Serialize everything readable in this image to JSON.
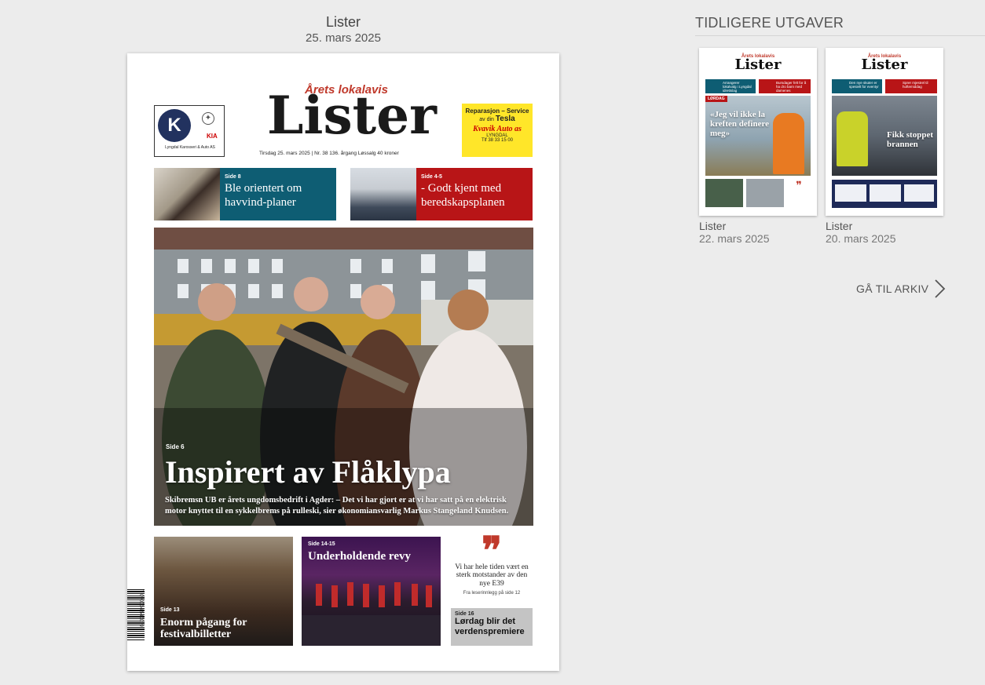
{
  "current": {
    "title": "Lister",
    "date": "25. mars 2025",
    "front": {
      "tagline": "Årets lokalavis",
      "masthead": "Lister",
      "dateline": "Tirsdag 25. mars 2025  |  Nr. 38        136. årgang   Løssalg 40 kroner",
      "left_ad": {
        "logo": "K",
        "mark": "✦",
        "brand": "KIA",
        "text": "Lyngdal Karosseri & Auto AS"
      },
      "right_ad": {
        "line1": "Reparasjon – Service",
        "line2": "av din",
        "brand": "Tesla",
        "company": "Kvavik Auto as",
        "place": "LYNGDAL",
        "phone": "Tlf 38 33 15 00"
      },
      "teasers": [
        {
          "side": "Side 8",
          "headline": "Ble orientert om havvind-planer",
          "color": "#0e5d73"
        },
        {
          "side": "Side 4-5",
          "headline": "- Godt kjent med beredskapsplanen",
          "color": "#b81517"
        }
      ],
      "hero": {
        "side": "Side 6",
        "headline": "Inspirert av Flåklypa",
        "subtext": "Skibremsn UB er årets ungdomsbedrift i Agder: – Det vi har gjort er at vi har satt på en elektrisk motor knyttet til en sykkelbrems på rulleski, sier økonomiansvarlig Markus Stangeland Knudsen."
      },
      "bottom": [
        {
          "side": "Side 13",
          "headline": "Enorm pågang for festivalbilletter"
        },
        {
          "side": "Side 14-15",
          "headline": "Underholdende revy"
        }
      ],
      "quote": {
        "mark": "❞",
        "text": "Vi har hele tiden vært en sterk motstander av den nye E39",
        "source": "Fra leserinnlegg på side 12"
      },
      "grey_box": {
        "side": "Side 16",
        "headline": "Lørdag blir det verdenspremiere"
      },
      "barcode_number": "7 090034 540019"
    }
  },
  "sidebar": {
    "heading": "TIDLIGERE UTGAVER",
    "editions": [
      {
        "title": "Lister",
        "date": "22. mars 2025",
        "tagline": "Årets lokalavis",
        "masthead": "Lister",
        "badge": "LØRDAG",
        "headline": "«Jeg vil ikke la kreften definere meg»",
        "teasers": [
          "Arrangerer lokalvalg i Lyngdal idrettslag",
          "Bursdager felt for å ha dro barn med damenes"
        ]
      },
      {
        "title": "Lister",
        "date": "20. mars 2025",
        "tagline": "Årets lokalavis",
        "masthead": "Lister",
        "headline": "Fikk stoppet brannen",
        "teasers": [
          "Den nye skuter er spesielt for eventyr",
          "Sprer mjestrel til hoftemiddag"
        ]
      }
    ],
    "archive_label": "GÅ TIL ARKIV"
  }
}
